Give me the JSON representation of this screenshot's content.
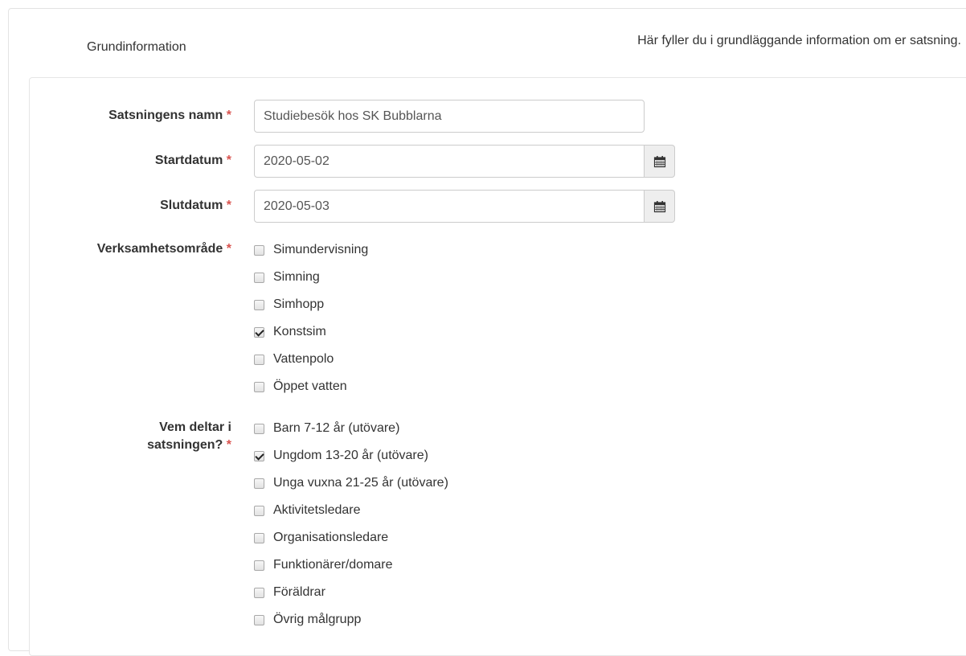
{
  "section": {
    "title": "Grundinformation",
    "description": "Här fyller du i grundläggande information om er satsning."
  },
  "form": {
    "required_marker": "*",
    "name": {
      "label": "Satsningens namn",
      "value": "Studiebesök hos SK Bubblarna"
    },
    "start_date": {
      "label": "Startdatum",
      "value": "2020-05-02",
      "icon": "calendar-icon"
    },
    "end_date": {
      "label": "Slutdatum",
      "value": "2020-05-03",
      "icon": "calendar-icon"
    },
    "area": {
      "label": "Verksamhetsområde",
      "options": [
        {
          "label": "Simundervisning",
          "checked": false
        },
        {
          "label": "Simning",
          "checked": false
        },
        {
          "label": "Simhopp",
          "checked": false
        },
        {
          "label": "Konstsim",
          "checked": true
        },
        {
          "label": "Vattenpolo",
          "checked": false
        },
        {
          "label": "Öppet vatten",
          "checked": false
        }
      ]
    },
    "participants": {
      "label_line1": "Vem deltar i",
      "label_line2": "satsningen?",
      "options": [
        {
          "label": "Barn 7-12 år (utövare)",
          "checked": false
        },
        {
          "label": "Ungdom 13-20 år (utövare)",
          "checked": true
        },
        {
          "label": "Unga vuxna 21-25 år (utövare)",
          "checked": false
        },
        {
          "label": "Aktivitetsledare",
          "checked": false
        },
        {
          "label": "Organisationsledare",
          "checked": false
        },
        {
          "label": "Funktionärer/domare",
          "checked": false
        },
        {
          "label": "Föräldrar",
          "checked": false
        },
        {
          "label": "Övrig målgrupp",
          "checked": false
        }
      ]
    }
  },
  "colors": {
    "required": "#d9534f",
    "border": "#cccccc",
    "addon_bg": "#eeeeee"
  }
}
